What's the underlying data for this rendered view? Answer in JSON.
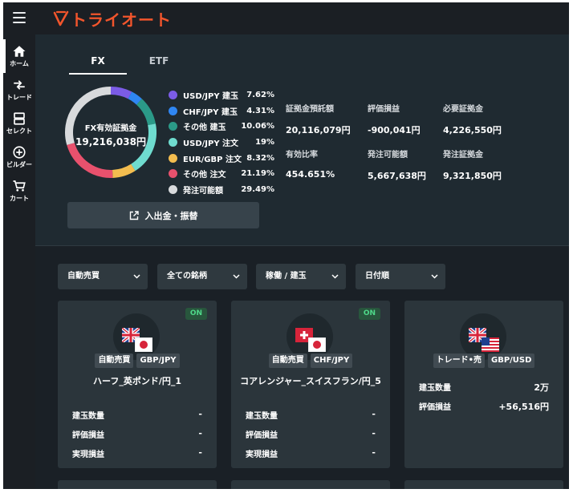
{
  "app": {
    "logo_text": "トライオート",
    "brand_color": "#f2552c"
  },
  "sidebar": {
    "items": [
      {
        "label": "ホーム",
        "icon": "home-icon"
      },
      {
        "label": "トレード",
        "icon": "trade-arrows-icon"
      },
      {
        "label": "セレクト",
        "icon": "select-icon"
      },
      {
        "label": "ビルダー",
        "icon": "plus-circle-icon"
      },
      {
        "label": "カート",
        "icon": "cart-icon"
      }
    ]
  },
  "tabs": [
    {
      "label": "FX",
      "active": true
    },
    {
      "label": "ETF",
      "active": false
    }
  ],
  "donut": {
    "label": "FX有効証拠金",
    "value": "19,216,038円",
    "segments": [
      {
        "name": "USD/JPY 建玉",
        "pct_label": "7.62%",
        "value": 7.62,
        "color": "#7b5ce6"
      },
      {
        "name": "CHF/JPY 建玉",
        "pct_label": "4.31%",
        "value": 4.31,
        "color": "#2f86f2"
      },
      {
        "name": "その他 建玉",
        "pct_label": "10.06%",
        "value": 10.06,
        "color": "#2b9a88"
      },
      {
        "name": "USD/JPY 注文",
        "pct_label": "19%",
        "value": 19,
        "color": "#6fdccf"
      },
      {
        "name": "EUR/GBP 注文",
        "pct_label": "8.32%",
        "value": 8.32,
        "color": "#f3bd4f"
      },
      {
        "name": "その他 注文",
        "pct_label": "21.19%",
        "value": 21.19,
        "color": "#e8516d"
      },
      {
        "name": "発注可能額",
        "pct_label": "29.49%",
        "value": 29.49,
        "color": "#d8dadc"
      }
    ]
  },
  "stats": [
    {
      "label": "証拠金預託額",
      "value": "20,116,079円"
    },
    {
      "label": "評価損益",
      "value": "-900,041円"
    },
    {
      "label": "必要証拠金",
      "value": "4,226,550円"
    },
    {
      "label": "有効比率",
      "value": "454.651%"
    },
    {
      "label": "発注可能額",
      "value": "5,667,638円"
    },
    {
      "label": "発注証拠金",
      "value": "9,321,850円"
    }
  ],
  "deposit_button": {
    "label": "入出金・振替"
  },
  "filters": [
    "自動売買",
    "全ての銘柄",
    "稼働 / 建玉",
    "日付順"
  ],
  "cards": [
    {
      "badge": "ON",
      "tag_type": "自動売買",
      "tag_pair": "GBP/JPY",
      "title": "ハーフ_英ポンド/円_1",
      "base_flag": "uk-flag-icon",
      "quote_flag": "japan-flag-icon",
      "rows": [
        {
          "label": "建玉数量",
          "value": "-"
        },
        {
          "label": "評価損益",
          "value": "-"
        },
        {
          "label": "実現損益",
          "value": "-"
        }
      ]
    },
    {
      "badge": "ON",
      "tag_type": "自動売買",
      "tag_pair": "CHF/JPY",
      "title": "コアレンジャー_スイスフラン/円_5",
      "base_flag": "swiss-flag-icon",
      "quote_flag": "japan-flag-icon",
      "rows": [
        {
          "label": "建玉数量",
          "value": "-"
        },
        {
          "label": "評価損益",
          "value": "-"
        },
        {
          "label": "実現損益",
          "value": "-"
        }
      ]
    },
    {
      "badge": "",
      "tag_type": "トレード•売",
      "tag_pair": "GBP/USD",
      "title": "",
      "base_flag": "uk-flag-icon",
      "quote_flag": "us-flag-icon",
      "rows": [
        {
          "label": "建玉数量",
          "value": "2万"
        },
        {
          "label": "評価損益",
          "value": "+56,516円"
        }
      ]
    }
  ]
}
